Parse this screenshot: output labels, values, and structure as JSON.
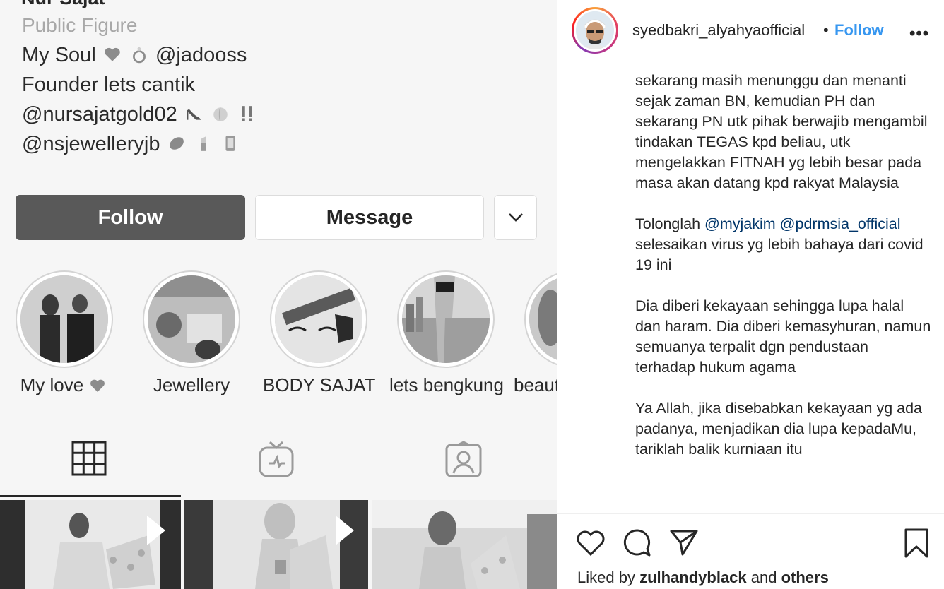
{
  "profile": {
    "name": "Nur Sajat",
    "category": "Public Figure",
    "bio": [
      {
        "text": "My Soul",
        "after": "@jadooss"
      },
      {
        "text": "Founder lets cantik"
      },
      {
        "text": "@nursajatgold02"
      },
      {
        "text": "@nsjewelleryjb"
      }
    ],
    "follow_label": "Follow",
    "message_label": "Message",
    "highlights": [
      "My love",
      "Jewellery",
      "BODY SAJAT",
      "lets bengkung",
      "beaut"
    ],
    "tabs": [
      "posts-grid",
      "igtv",
      "tagged"
    ]
  },
  "post": {
    "username": "syedbakri_alyahyaofficial",
    "separator": "•",
    "follow_label": "Follow",
    "more_label": "•••",
    "caption_paragraphs": [
      {
        "text": "sekarang masih menunggu dan menanti sejak zaman BN, kemudian PH dan sekarang PN utk pihak berwajib mengambil tindakan TEGAS kpd beliau, utk mengelakkan FITNAH yg lebih besar pada masa akan datang kpd rakyat Malaysia"
      },
      {
        "prefix": "Tolonglah ",
        "mention1": "@myjakim",
        "mention2": "@pdrmsia_official",
        "suffix": " selesaikan virus yg lebih bahaya dari covid 19 ini"
      },
      {
        "text": "Dia diberi kekayaan sehingga lupa halal dan haram. Dia diberi kemasyhuran, namun semuanya terpalit dgn pendustaan terhadap hukum agama"
      },
      {
        "text": "Ya Allah, jika disebabkan kekayaan yg ada padanya, menjadikan dia lupa kepadaMu, tariklah balik kurniaan itu"
      }
    ],
    "liked_prefix": "Liked by ",
    "liked_user": "zulhandyblack",
    "liked_mid": " and ",
    "liked_suffix": "others"
  },
  "colors": {
    "link": "#3897f0",
    "mention": "#003569",
    "follow_dark": "#595959"
  }
}
